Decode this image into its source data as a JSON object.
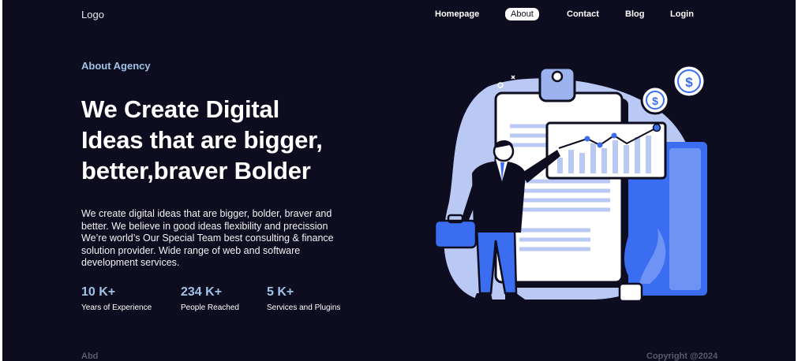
{
  "header": {
    "logo": "Logo",
    "nav": [
      {
        "label": "Homepage",
        "active": false
      },
      {
        "label": "About",
        "active": true
      },
      {
        "label": "Contact",
        "active": false
      },
      {
        "label": "Blog",
        "active": false
      },
      {
        "label": "Login",
        "active": false
      }
    ]
  },
  "hero": {
    "eyebrow": "About Agency",
    "headline_lines": [
      "We Create Digital",
      "Ideas that are bigger,",
      "better,braver Bolder"
    ],
    "description_lines": [
      "We create digital ideas that are bigger, bolder, braver and",
      "better. We believe in good ideas flexibility and precission",
      "We’re world’s Our Special Team best consulting & finance",
      "solution provider. Wide range of web and software",
      "development services."
    ]
  },
  "stats": [
    {
      "value": "10 K+",
      "label": "Years of Experience"
    },
    {
      "value": "234 K+",
      "label": "People Reached"
    },
    {
      "value": "5 K+",
      "label": "Services and Plugins"
    }
  ],
  "illustration": {
    "icon": "businessman-presenting-chart-illustration",
    "coin_symbol": "$"
  },
  "footer": {
    "left": "Abd",
    "right": "Copyright @2024"
  },
  "colors": {
    "background": "#0d0d1f",
    "accent": "#9fc3e6",
    "illustration_blue": "#3b6df0",
    "illustration_light": "#b9c9f4"
  }
}
